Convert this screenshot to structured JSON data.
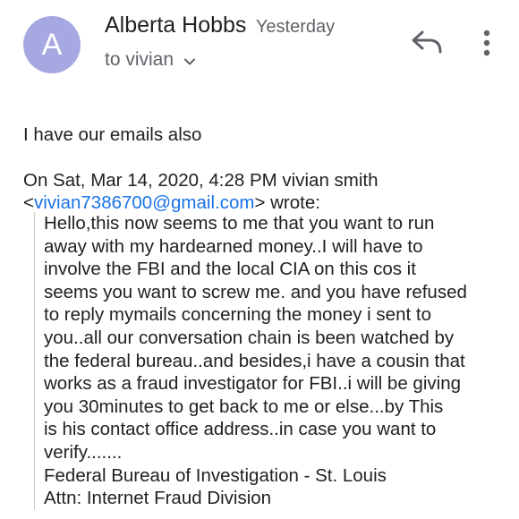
{
  "header": {
    "avatar_letter": "A",
    "sender_name": "Alberta Hobbs",
    "time": "Yesterday",
    "recipient": "to vivian",
    "avatar_color": "#a6a9e1",
    "icons": [
      "reply-icon",
      "more-vert-icon",
      "chevron-down-icon"
    ]
  },
  "message": {
    "reply_text": "I have our emails also",
    "attribution_prefix": "On Sat, Mar 14, 2020, 4:28 PM vivian smith",
    "attribution_open": "<",
    "attribution_email": "vivian7386700@gmail.com",
    "attribution_close": "> wrote:",
    "quoted_lines": [
      "Hello,this now seems to me that you want to run",
      "away with my hardearned money..I will have to",
      "involve the FBI and the local CIA on this cos it",
      "seems you want to screw me. and you have refused",
      "to reply mymails concerning the money i sent to",
      "you..all our conversation chain is been watched by",
      "the federal bureau..and besides,i have a cousin that",
      "works as a fraud investigator for FBI..i will be giving",
      "you 30minutes to get back to me  or else...by This",
      "is his contact office address..in case you want to",
      "verify.......",
      "Federal Bureau of Investigation - St. Louis",
      "Attn: Internet Fraud Division"
    ],
    "link_color": "#1a73e8"
  }
}
